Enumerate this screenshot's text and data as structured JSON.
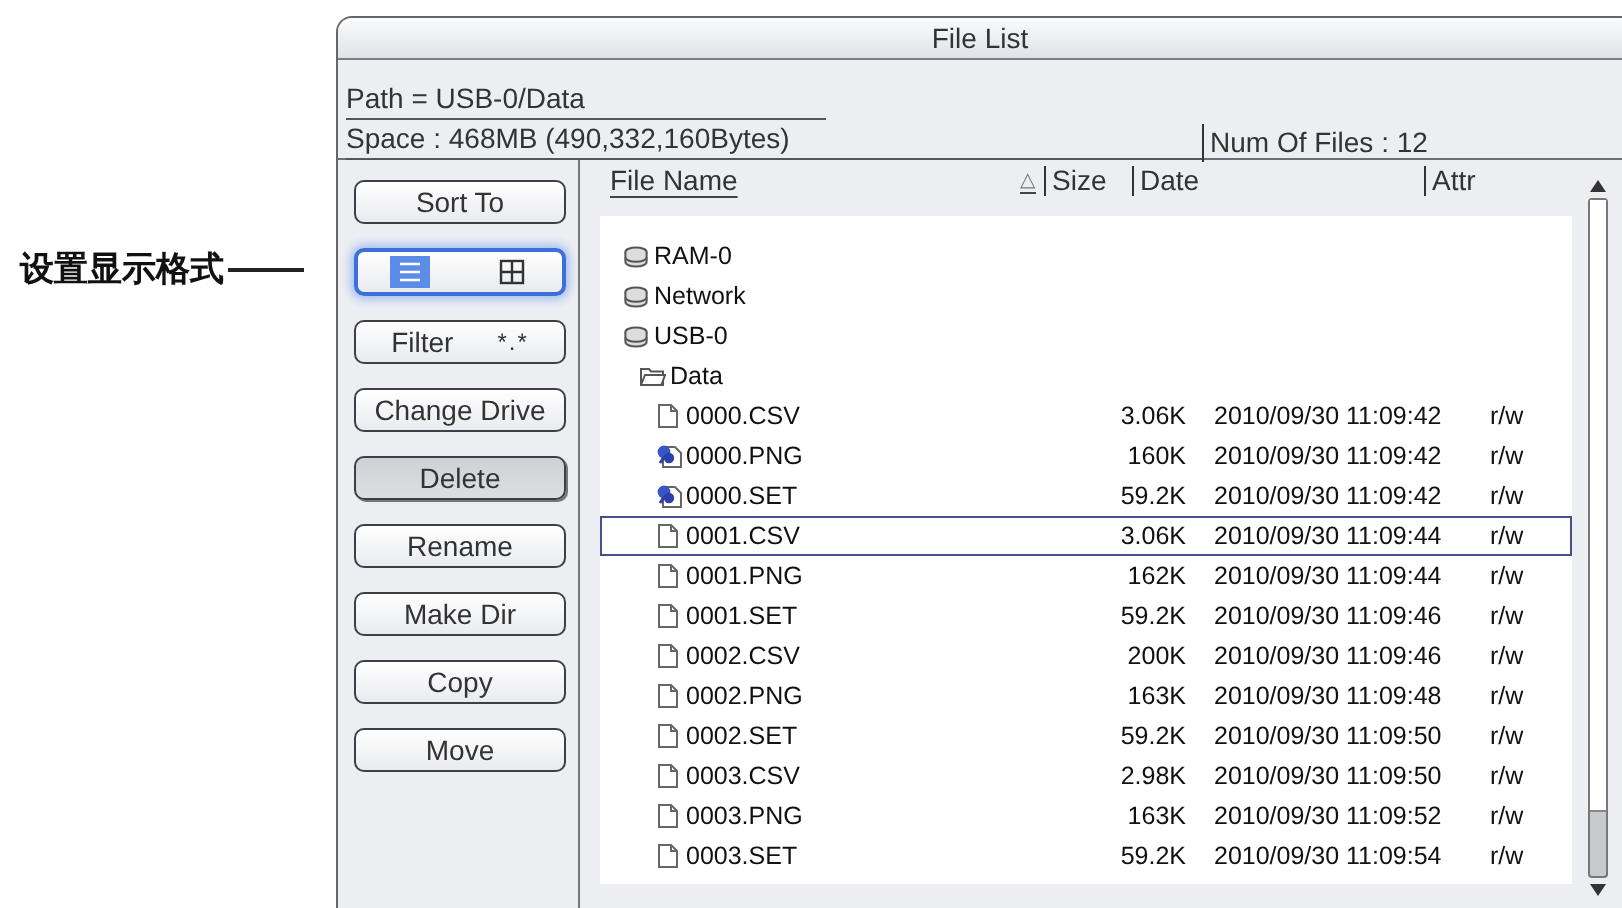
{
  "callout": {
    "label": "设置显示格式"
  },
  "window": {
    "title": "File List"
  },
  "path": "Path = USB-0/Data",
  "space": "Space : 468MB (490,332,160Bytes)",
  "num_files": "Num Of Files : 12",
  "buttons": [
    {
      "kind": "text",
      "label": "Sort To",
      "pressed": false
    },
    {
      "kind": "format",
      "focused": true,
      "options": [
        {
          "kind": "list",
          "selected": true
        },
        {
          "kind": "grid",
          "selected": false
        }
      ]
    },
    {
      "kind": "filter",
      "label": "Filter",
      "value": "*.*",
      "pressed": false
    },
    {
      "kind": "text",
      "label": "Change Drive",
      "pressed": false
    },
    {
      "kind": "text",
      "label": "Delete",
      "pressed": true
    },
    {
      "kind": "text",
      "label": "Rename",
      "pressed": false
    },
    {
      "kind": "text",
      "label": "Make Dir",
      "pressed": false
    },
    {
      "kind": "text",
      "label": "Copy",
      "pressed": false
    },
    {
      "kind": "text",
      "label": "Move",
      "pressed": false
    }
  ],
  "columns": [
    {
      "label": "File Name",
      "sort": "△"
    },
    {
      "label": "Size"
    },
    {
      "label": "Date"
    },
    {
      "label": "Attr"
    }
  ],
  "tree": [
    {
      "kind": "drive",
      "name": "RAM-0",
      "selected": false
    },
    {
      "kind": "drive",
      "name": "Network",
      "selected": false
    },
    {
      "kind": "drive",
      "name": "USB-0",
      "selected": false,
      "children": [
        {
          "kind": "folder",
          "name": "Data",
          "selected": false,
          "children": [
            {
              "kind": "file",
              "name": "0000.CSV",
              "size": "3.06K",
              "date": "2010/09/30 11:09:42",
              "attr": "r/w",
              "selected": false
            },
            {
              "kind": "marked",
              "name": "0000.PNG",
              "size": "160K",
              "date": "2010/09/30 11:09:42",
              "attr": "r/w",
              "selected": false
            },
            {
              "kind": "marked",
              "name": "0000.SET",
              "size": "59.2K",
              "date": "2010/09/30 11:09:42",
              "attr": "r/w",
              "selected": false
            },
            {
              "kind": "file",
              "name": "0001.CSV",
              "size": "3.06K",
              "date": "2010/09/30 11:09:44",
              "attr": "r/w",
              "selected": true
            },
            {
              "kind": "file",
              "name": "0001.PNG",
              "size": "162K",
              "date": "2010/09/30 11:09:44",
              "attr": "r/w",
              "selected": false
            },
            {
              "kind": "file",
              "name": "0001.SET",
              "size": "59.2K",
              "date": "2010/09/30 11:09:46",
              "attr": "r/w",
              "selected": false
            },
            {
              "kind": "file",
              "name": "0002.CSV",
              "size": "200K",
              "date": "2010/09/30 11:09:46",
              "attr": "r/w",
              "selected": false
            },
            {
              "kind": "file",
              "name": "0002.PNG",
              "size": "163K",
              "date": "2010/09/30 11:09:48",
              "attr": "r/w",
              "selected": false
            },
            {
              "kind": "file",
              "name": "0002.SET",
              "size": "59.2K",
              "date": "2010/09/30 11:09:50",
              "attr": "r/w",
              "selected": false
            },
            {
              "kind": "file",
              "name": "0003.CSV",
              "size": "2.98K",
              "date": "2010/09/30 11:09:50",
              "attr": "r/w",
              "selected": false
            },
            {
              "kind": "file",
              "name": "0003.PNG",
              "size": "163K",
              "date": "2010/09/30 11:09:52",
              "attr": "r/w",
              "selected": false
            },
            {
              "kind": "file",
              "name": "0003.SET",
              "size": "59.2K",
              "date": "2010/09/30 11:09:54",
              "attr": "r/w",
              "selected": false
            }
          ]
        }
      ]
    }
  ]
}
